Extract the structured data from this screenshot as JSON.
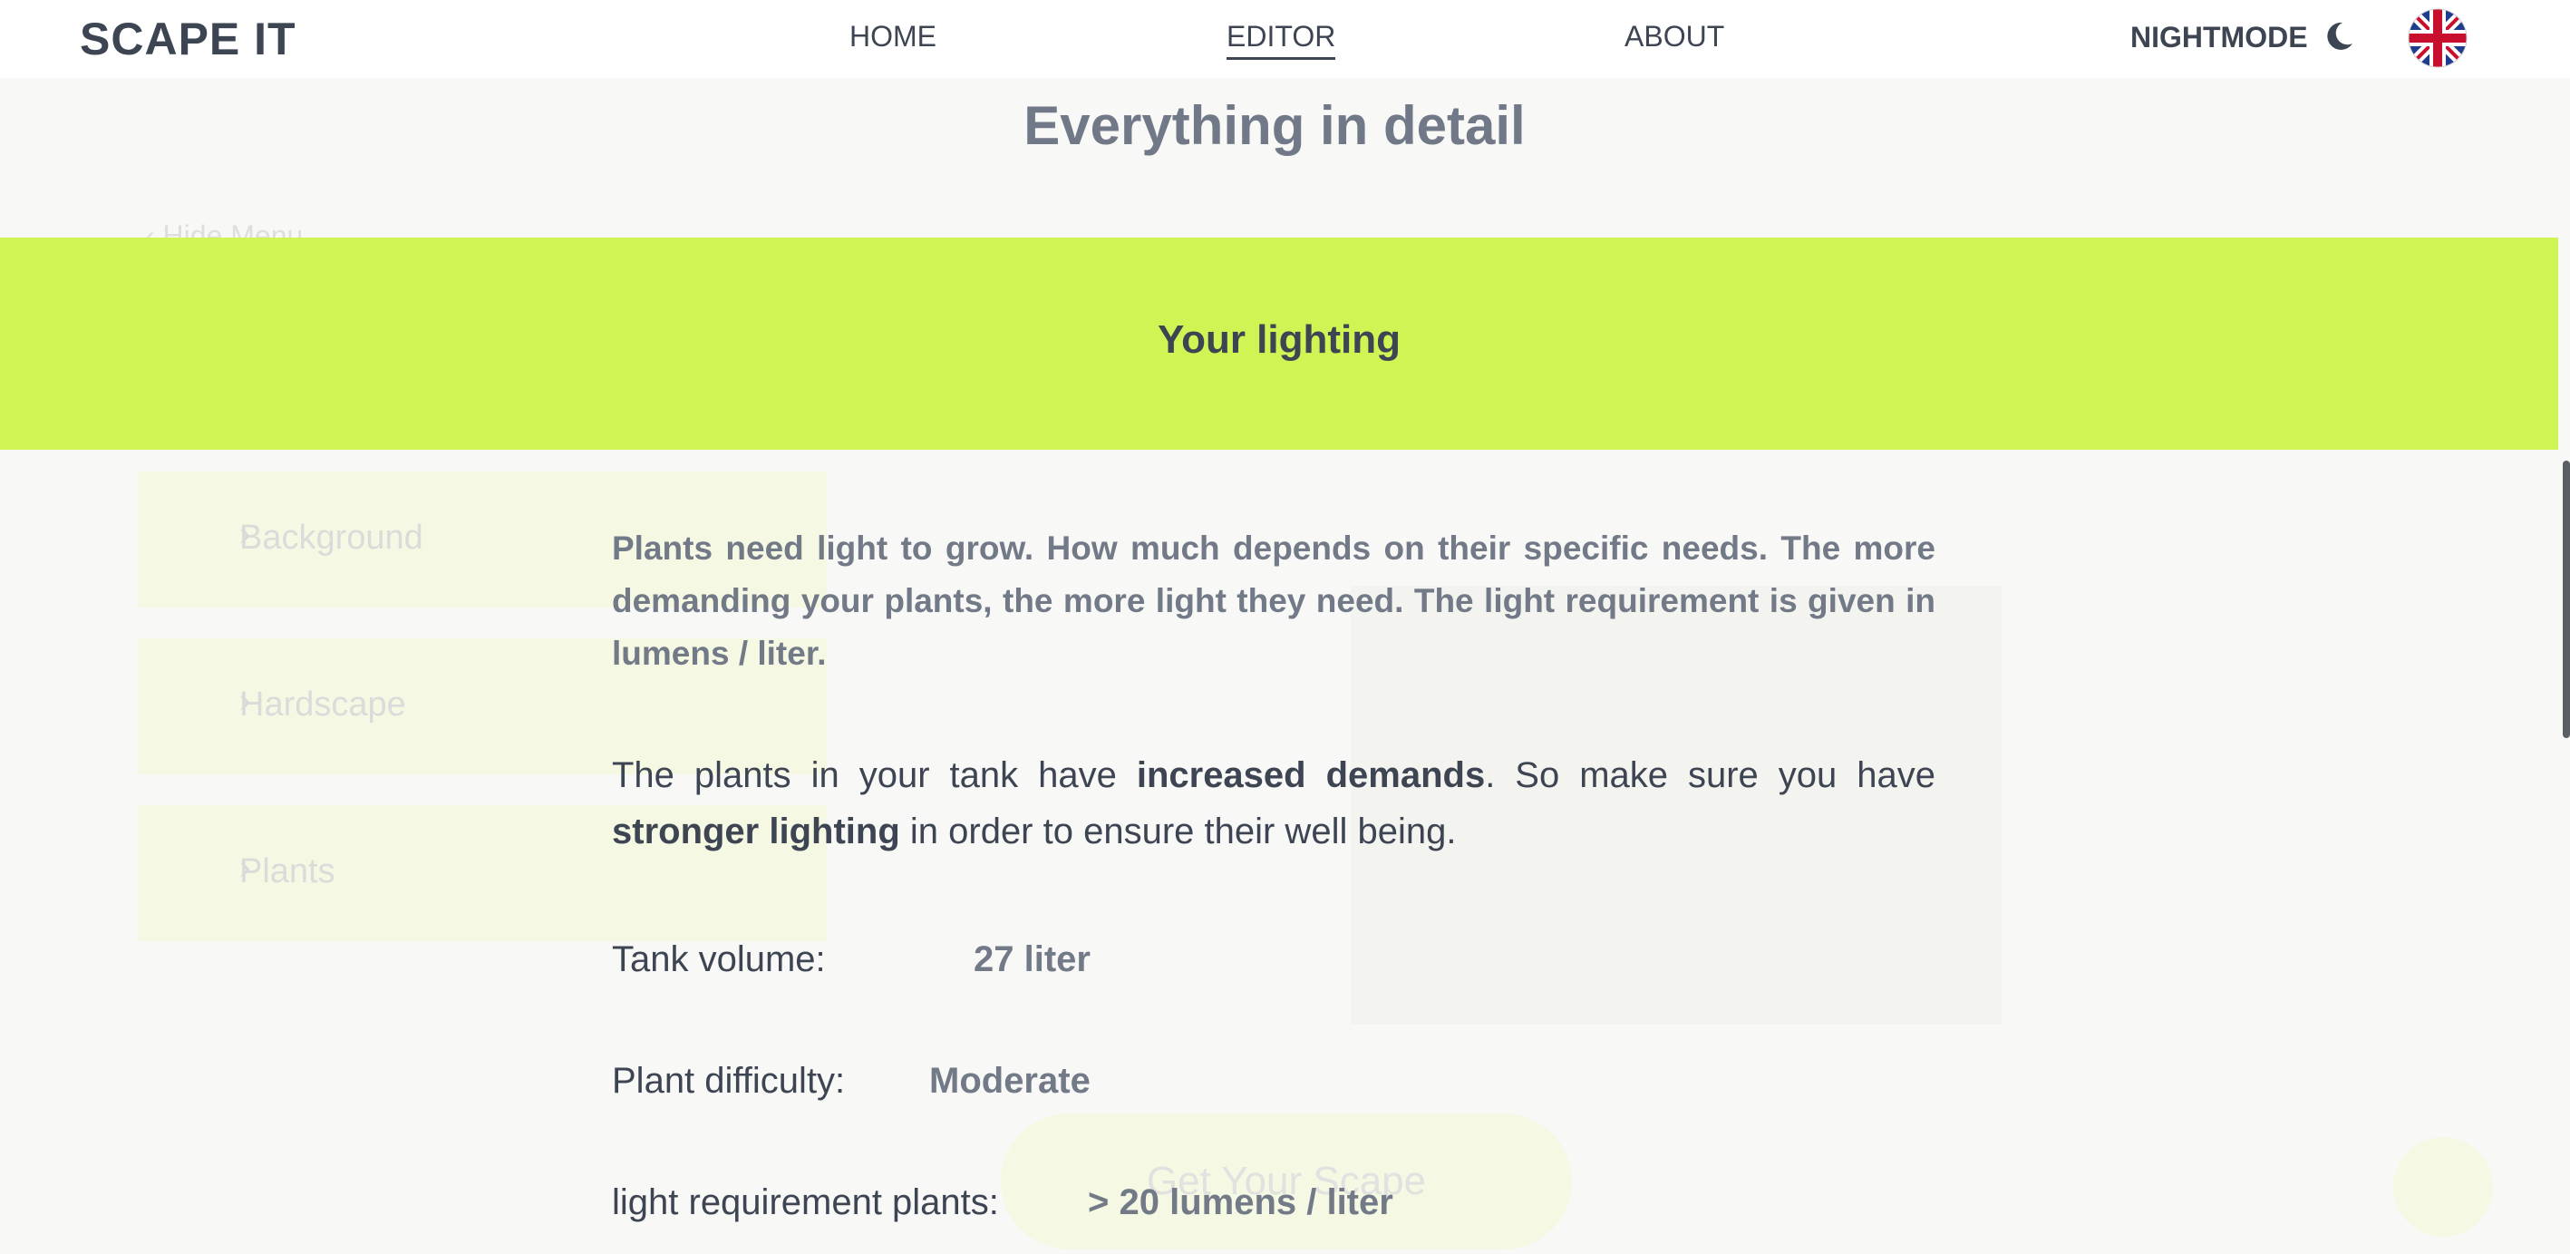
{
  "nav": {
    "brand": "SCAPE IT",
    "links": [
      "HOME",
      "EDITOR",
      "ABOUT"
    ],
    "active": "EDITOR",
    "nightmode_label": "NIGHTMODE",
    "language_icon": "uk-flag-icon"
  },
  "background_page": {
    "back_link": "‹ Hide Menu",
    "side_items": [
      "Background",
      "Hardscape",
      "Plants"
    ],
    "cta_label": "Get Your Scape"
  },
  "detail": {
    "title": "Everything in detail",
    "section_title": "Your lighting",
    "intro": "Plants need light to grow. How much depends on their specific needs. The more demanding your plants, the more light they need. The light requirement is given in lumens / liter.",
    "demand_pre": "The plants in your tank have ",
    "demand_bold1": "increased demands",
    "demand_mid": ". So make sure you have ",
    "demand_bold2": "stronger lighting",
    "demand_post": " in order to ensure their well being.",
    "rows": [
      {
        "label": "Tank volume:",
        "value": "27 liter"
      },
      {
        "label": "Plant difficulty:",
        "value": "Moderate"
      },
      {
        "label": "light requirement plants:",
        "value": "> 20 lumens / liter"
      }
    ]
  },
  "colors": {
    "accent": "#cff555",
    "text": "#3d4553",
    "muted": "#727987"
  }
}
